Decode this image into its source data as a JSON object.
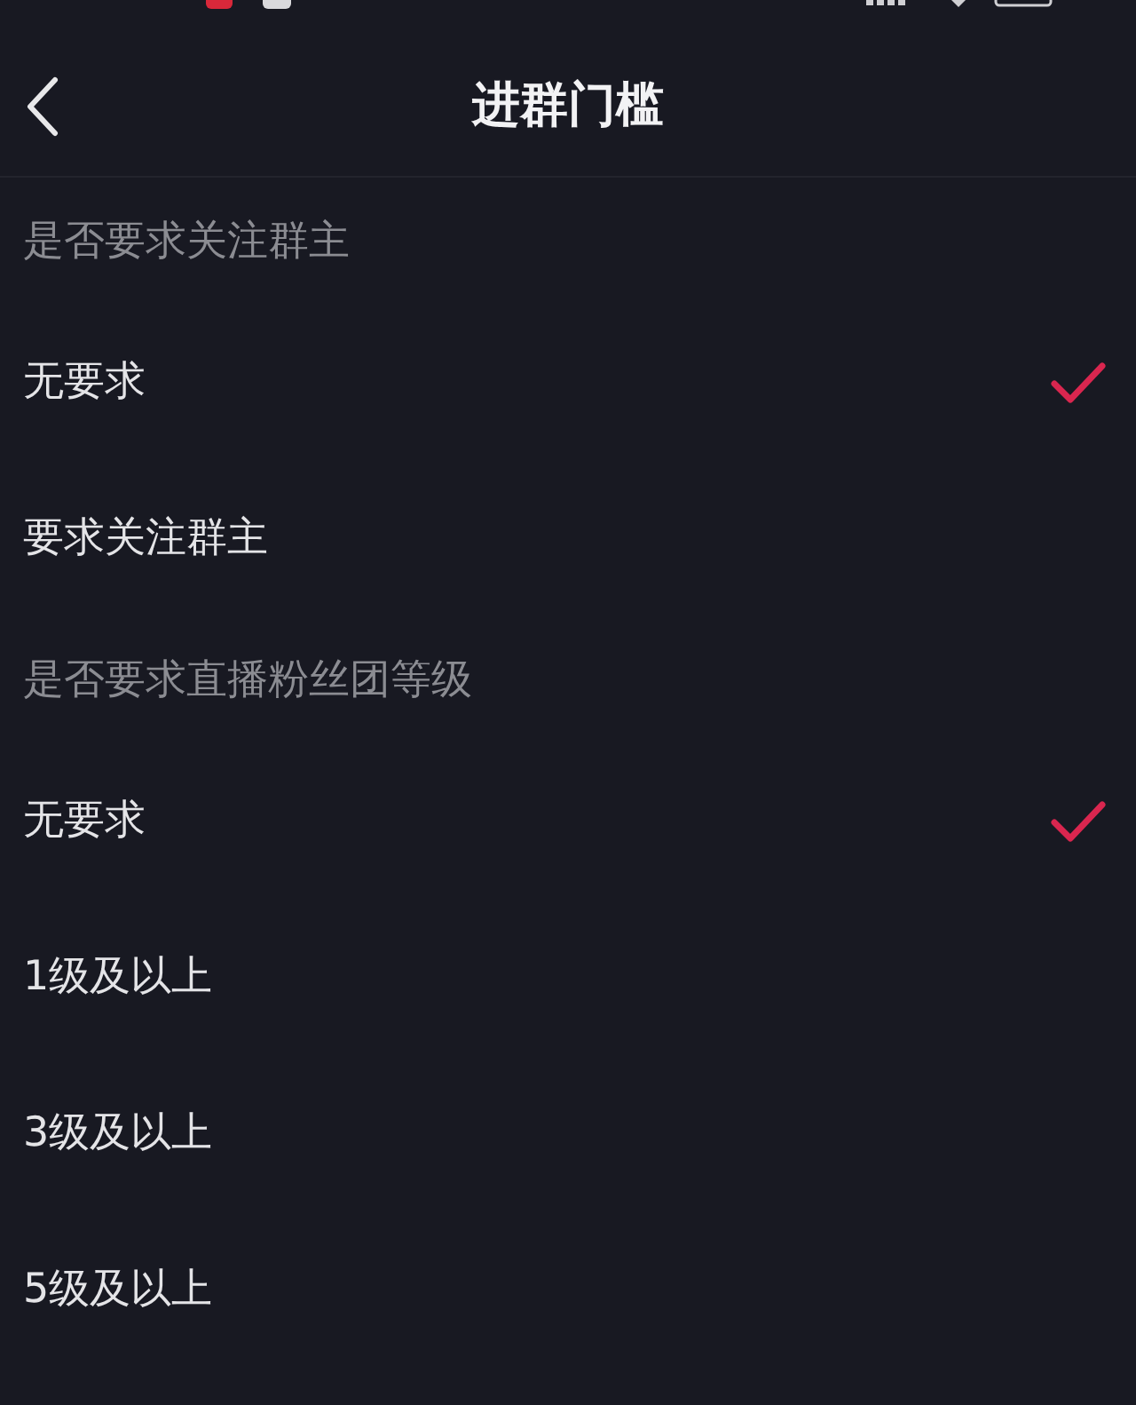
{
  "header": {
    "title": "进群门槛"
  },
  "sections": [
    {
      "title": "是否要求关注群主",
      "options": [
        {
          "label": "无要求",
          "selected": true
        },
        {
          "label": "要求关注群主",
          "selected": false
        }
      ]
    },
    {
      "title": "是否要求直播粉丝团等级",
      "options": [
        {
          "label": "无要求",
          "selected": true
        },
        {
          "label": "1级及以上",
          "selected": false
        },
        {
          "label": "3级及以上",
          "selected": false
        },
        {
          "label": "5级及以上",
          "selected": false
        }
      ]
    }
  ]
}
